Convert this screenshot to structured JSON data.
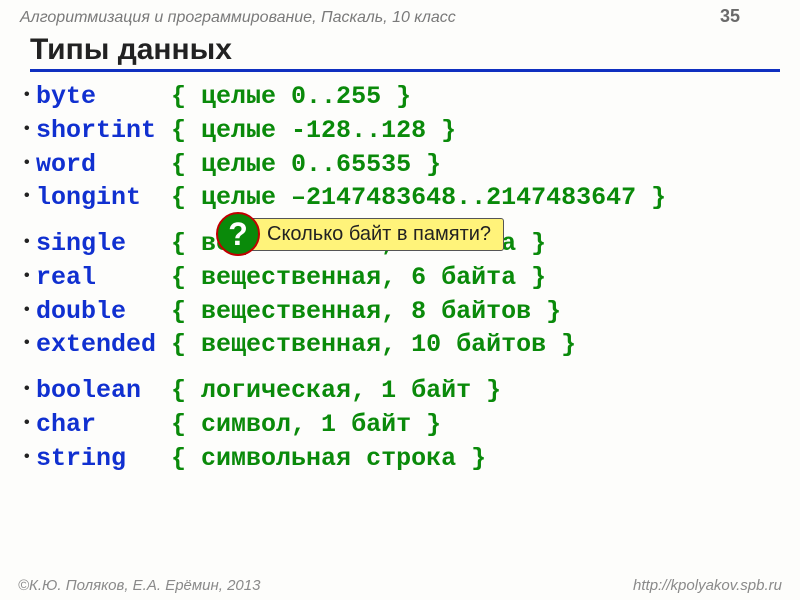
{
  "header": {
    "course": "Алгоритмизация и программирование, Паскаль, 10 класс",
    "page": "35"
  },
  "title": "Типы данных",
  "rows": [
    {
      "kw": "byte    ",
      "cm": " { целые 0..255 }"
    },
    {
      "kw": "shortint",
      "cm": " { целые -128..128 }"
    },
    {
      "kw": "word    ",
      "cm": " { целые 0..65535 }"
    },
    {
      "kw": "longint ",
      "cm": " { целые –2147483648..2147483647 }"
    }
  ],
  "rows2": [
    {
      "kw": "single  ",
      "cm": " { вещественная, 4 байта }"
    },
    {
      "kw": "real    ",
      "cm": " { вещественная, 6 байта }"
    },
    {
      "kw": "double  ",
      "cm": " { вещественная, 8 байтов }"
    },
    {
      "kw": "extended",
      "cm": " { вещественная, 10 байтов }"
    }
  ],
  "rows3": [
    {
      "kw": "boolean ",
      "cm": " { логическая, 1 байт }"
    },
    {
      "kw": "char    ",
      "cm": " { символ, 1 байт }"
    },
    {
      "kw": "string  ",
      "cm": " { символьная строка }"
    }
  ],
  "callout": {
    "mark": "?",
    "text": "Сколько байт в памяти?"
  },
  "footer": {
    "left": "©К.Ю. Поляков, Е.А. Ерёмин, 2013",
    "right": "http://kpolyakov.spb.ru"
  }
}
